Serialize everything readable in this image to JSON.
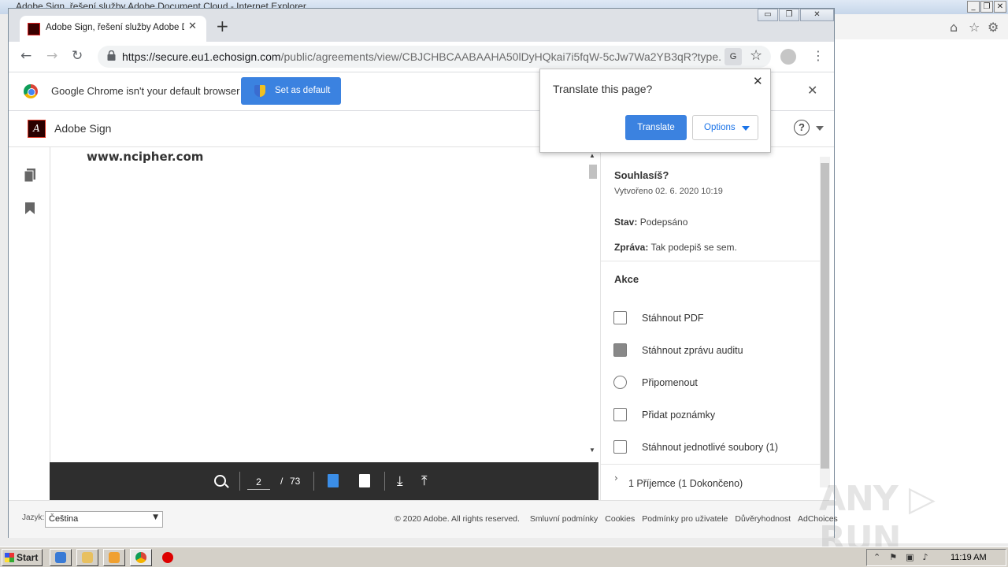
{
  "ie": {
    "title": "Adobe Sign, řešení služby Adobe Document Cloud - Internet Explorer",
    "controls": [
      "_",
      "❐",
      "✕"
    ],
    "toolbar_icons": [
      "home-icon",
      "star-icon",
      "gear-icon"
    ]
  },
  "chrome": {
    "tab": {
      "title": "Adobe Sign, řešení služby Adobe Do",
      "close": "✕"
    },
    "new_tab": "+",
    "window_controls": [
      "▭",
      "❐",
      "✕"
    ],
    "omnibox": {
      "host": "https://secure.eu1.echosign.com",
      "path": "/public/agreements/view/CBJCHBCAABAAHA50lDyHQkai7i5fqW-5cJw7Wa2YB3qR?type..."
    },
    "translate_icon_label": "G",
    "infobar": {
      "message": "Google Chrome isn't your default browser",
      "button": "Set as default",
      "close": "✕"
    }
  },
  "translate_popup": {
    "title": "Translate this page?",
    "close": "✕",
    "translate_button": "Translate",
    "options_button": "Options"
  },
  "app": {
    "name": "Adobe Sign",
    "help": "?"
  },
  "document": {
    "visible_text": "www.ncipher.com",
    "current_page": "2",
    "separator": "/",
    "total_pages": "73"
  },
  "agreement": {
    "title": "Souhlasíš?",
    "created": "Vytvořeno 02. 6. 2020 10:19",
    "status_label": "Stav:",
    "status_value": "Podepsáno",
    "message_label": "Zpráva:",
    "message_value": "Tak podepiš se sem."
  },
  "actions": {
    "title": "Akce",
    "items": [
      {
        "label": "Stáhnout PDF",
        "icon": "download-pdf-icon"
      },
      {
        "label": "Stáhnout zprávu auditu",
        "icon": "audit-report-icon"
      },
      {
        "label": "Připomenout",
        "icon": "alarm-clock-icon"
      },
      {
        "label": "Přidat poznámky",
        "icon": "note-icon"
      },
      {
        "label": "Stáhnout jednotlivé soubory (1)",
        "icon": "download-files-icon"
      }
    ]
  },
  "recipients": {
    "label": "1 Příjemce (1 Dokončeno)"
  },
  "footer": {
    "language_label": "Jazyk:",
    "language_value": "Čeština",
    "copyright": "© 2020 Adobe. All rights reserved.",
    "links": [
      "Smluvní podmínky",
      "Cookies",
      "Podmínky pro uživatele",
      "Důvěryhodnost",
      "AdChoices"
    ]
  },
  "watermark": "ANY ▷ RUN",
  "taskbar": {
    "start": "Start",
    "clock": "11:19 AM"
  }
}
